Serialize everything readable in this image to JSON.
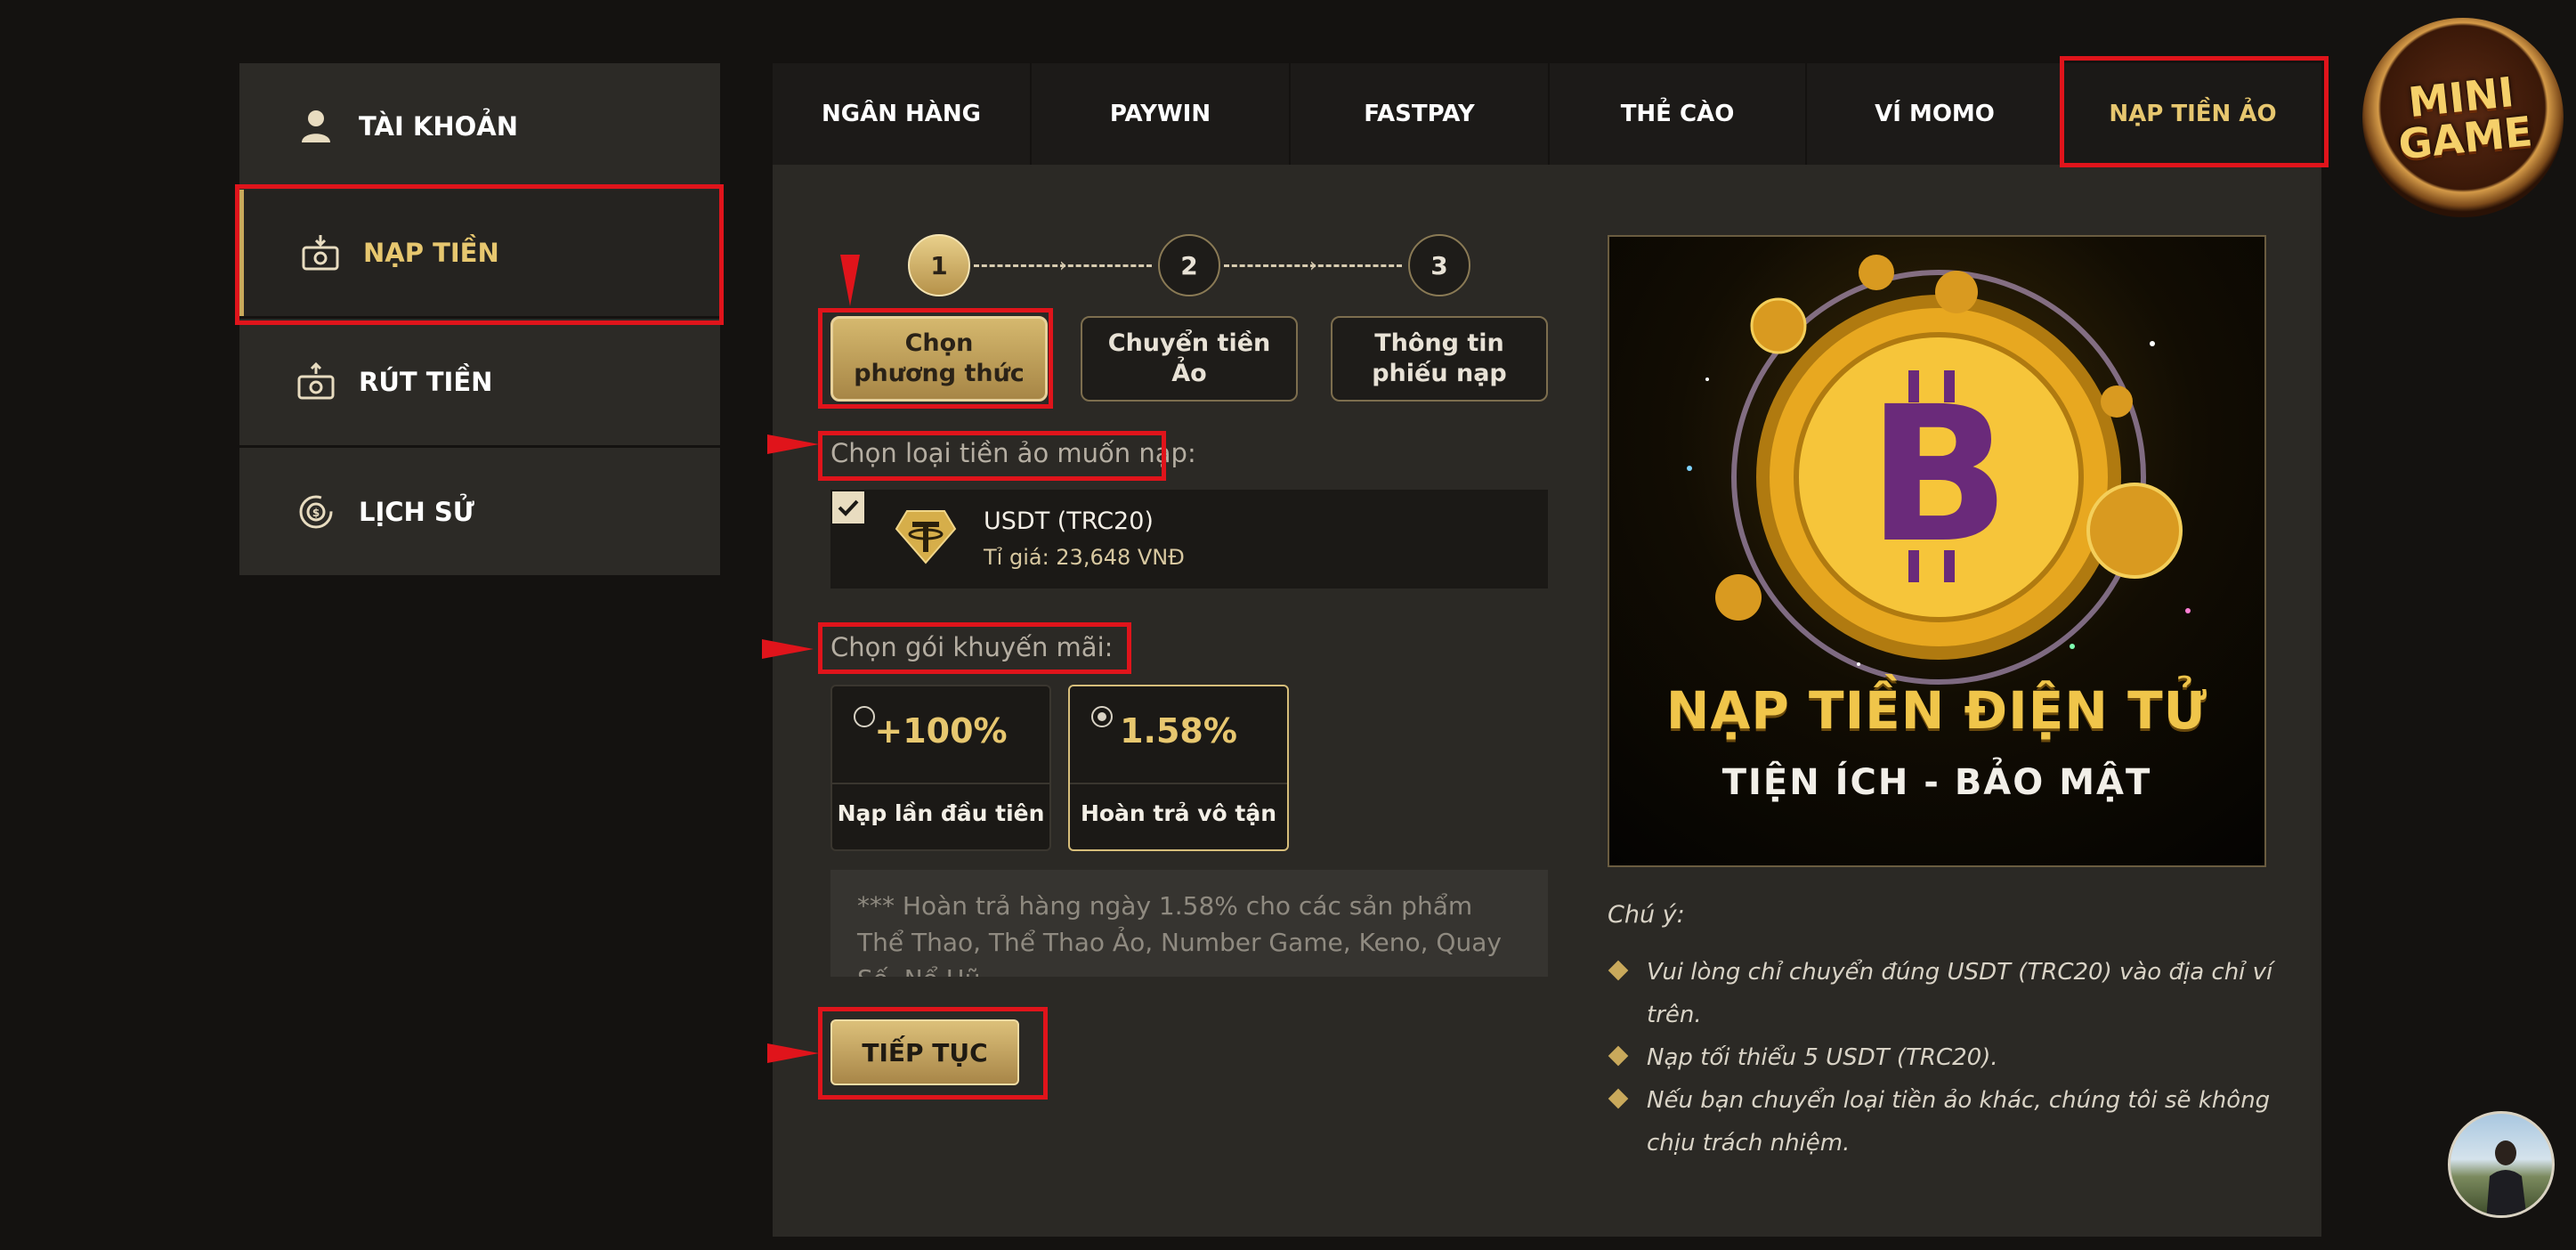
{
  "sidebar": {
    "items": [
      {
        "label": "TÀI KHOẢN",
        "icon": "user-icon"
      },
      {
        "label": "NẠP TIỀN",
        "icon": "money-deposit-icon"
      },
      {
        "label": "RÚT TIỀN",
        "icon": "money-withdraw-icon"
      },
      {
        "label": "LỊCH SỬ",
        "icon": "history-icon"
      }
    ],
    "active_index": 1
  },
  "tabs": [
    {
      "label": "NGÂN HÀNG"
    },
    {
      "label": "PAYWIN"
    },
    {
      "label": "FASTPAY"
    },
    {
      "label": "THẺ CÀO"
    },
    {
      "label": "VÍ MOMO"
    },
    {
      "label": "NẠP TIỀN ẢO"
    }
  ],
  "active_tab_index": 5,
  "steps": [
    {
      "number": "1",
      "label_line1": "Chọn",
      "label_line2": "phương thức"
    },
    {
      "number": "2",
      "label_line1": "Chuyển tiền",
      "label_line2": "Ảo"
    },
    {
      "number": "3",
      "label_line1": "Thông tin",
      "label_line2": "phiếu nạp"
    }
  ],
  "current_step": 1,
  "coin_section": {
    "label": "Chọn loại tiền ảo muốn nạp:",
    "coin_name": "USDT (TRC20)",
    "rate": "Tỉ giá: 23,648 VNĐ",
    "checked": true
  },
  "promo_section": {
    "label": "Chọn gói khuyến mãi:",
    "options": [
      {
        "value": "+100%",
        "caption": "Nạp lần đầu tiên",
        "selected": false
      },
      {
        "value": "1.58%",
        "caption": "Hoàn trả vô tận",
        "selected": true
      }
    ]
  },
  "promo_note": "*** Hoàn trả hàng ngày 1.58% cho các sản phẩm Thể Thao, Thể Thao Ảo, Number Game, Keno, Quay Số, Nổ Hũ",
  "continue_label": "TIẾP TỤC",
  "banner": {
    "title": "NẠP TIỀN ĐIỆN TỬ",
    "subtitle": "TIỆN ÍCH - BẢO MẬT"
  },
  "notes": {
    "title": "Chú ý:",
    "items": [
      "Vui lòng chỉ chuyển đúng USDT (TRC20) vào địa chỉ ví trên.",
      "Nạp tối thiểu 5 USDT (TRC20).",
      "Nếu bạn chuyển loại tiền ảo khác, chúng tôi sẽ không chịu trách nhiệm."
    ]
  },
  "logo": {
    "line1": "MINI",
    "line2": "GAME"
  },
  "colors": {
    "accent": "#e7c76f",
    "highlight": "#e0141b",
    "panel": "#2b2925"
  }
}
